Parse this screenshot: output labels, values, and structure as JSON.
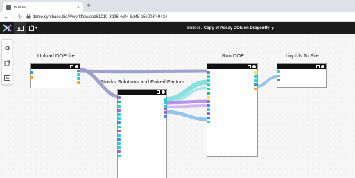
{
  "browser": {
    "tab_title": "Builder",
    "tab_close": "×",
    "new_tab": "+",
    "url": "demo.synthace.bio/#/workflow/ced61010-3d96-4c04-8a48-c5e003f49434",
    "back": "←",
    "forward": "→",
    "reload": "↻",
    "lock": "🔒"
  },
  "toolbar": {
    "breadcrumb_root": "Builder",
    "breadcrumb_sep": " / ",
    "breadcrumb_current": "Copy of Assay DOE on Dragonfly",
    "caret": "▾",
    "menu_caret": "▾"
  },
  "blocks": [
    {
      "title": "Upload DOE file"
    },
    {
      "title": "Stocks Solutions and Paired Factors"
    },
    {
      "title": "Run DOE"
    },
    {
      "title": "Liquids To File"
    }
  ],
  "colors": {
    "block_header": "#101010",
    "wire_lavender": "#9b9bc7",
    "wire_teal": "#6ed9d9",
    "wire_purple": "#b487e6",
    "wire_blue": "#8cc0ea",
    "port_teal": "#33cccc",
    "port_purple": "#9966cc",
    "port_orange": "#f5a623",
    "port_blue": "#3b8ede",
    "port_yellow": "#f3e05a",
    "port_green": "#22bb77",
    "port_gray": "#b0b0b0"
  }
}
